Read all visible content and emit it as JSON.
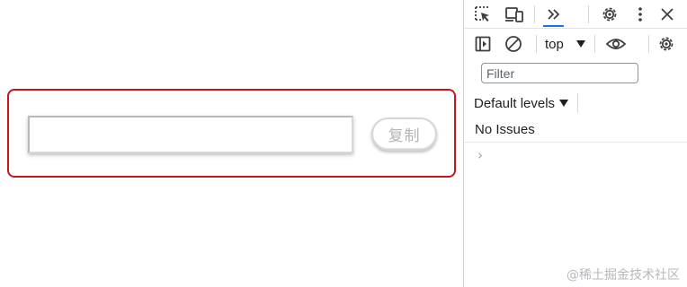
{
  "page": {
    "input_value": "",
    "copy_button_label": "复制",
    "highlight_color": "#c4161c"
  },
  "devtools": {
    "toolbar": {
      "icons": [
        "inspect-element-icon",
        "device-toolbar-icon",
        "more-tabs-icon",
        "settings-icon",
        "kebab-menu-icon",
        "close-icon"
      ],
      "active_tab_color": "#1a73e8"
    },
    "console_toolbar": {
      "icons": [
        "sidebar-toggle-icon",
        "clear-console-icon",
        "live-expression-eye-icon",
        "console-settings-icon"
      ],
      "context_label": "top"
    },
    "filter": {
      "placeholder": "Filter"
    },
    "levels": {
      "label": "Default levels"
    },
    "issues_text": "No Issues",
    "prompt_symbol": "›"
  },
  "watermark": "@稀土掘金技术社区"
}
